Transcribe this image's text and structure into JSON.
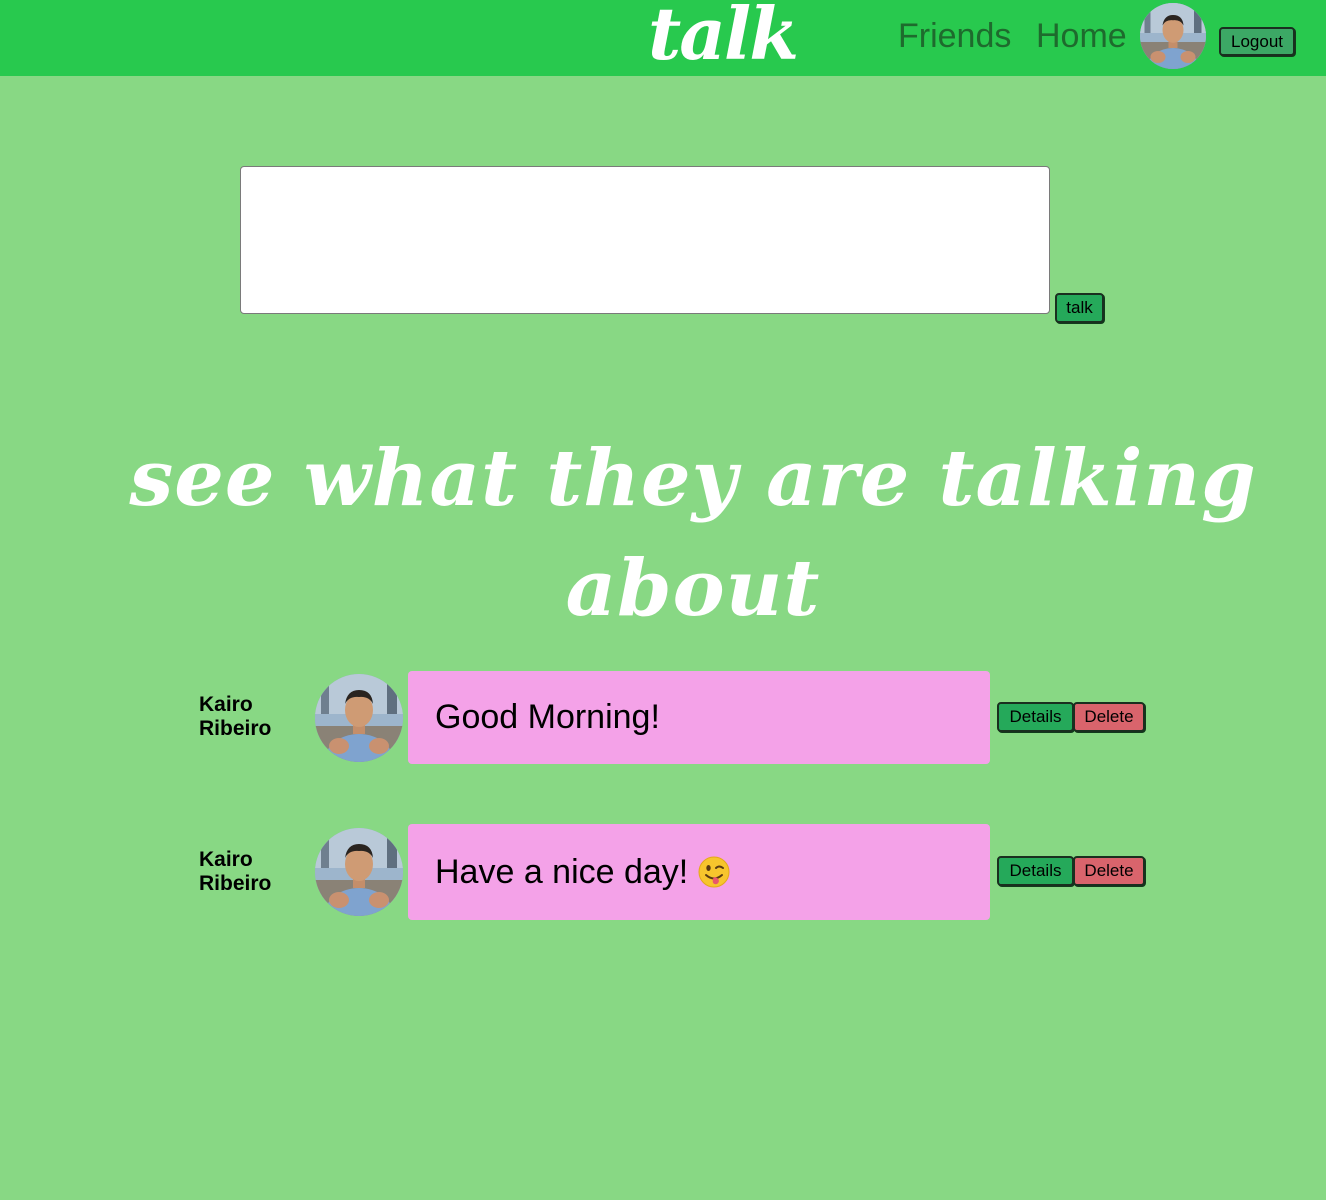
{
  "header": {
    "logo": "talk",
    "nav": {
      "friends": "Friends",
      "home": "Home"
    },
    "logout_label": "Logout",
    "avatar_icon": "user-avatar-icon"
  },
  "compose": {
    "value": "",
    "placeholder": "",
    "submit_label": "talk"
  },
  "feed": {
    "headline": "see what they are talking about",
    "posts": [
      {
        "author": "Kairo Ribeiro",
        "text": "Good Morning!",
        "emoji": "",
        "details_label": "Details",
        "delete_label": "Delete"
      },
      {
        "author": "Kairo Ribeiro",
        "text": "Have a nice day!",
        "emoji": "winking-face-with-tongue-emoji",
        "details_label": "Details",
        "delete_label": "Delete"
      }
    ]
  },
  "colors": {
    "page_bg": "#88d884",
    "header_bg": "#28c94e",
    "bubble_bg": "#f4a2e8",
    "details_btn": "#25a95a",
    "delete_btn": "#d9646c"
  }
}
